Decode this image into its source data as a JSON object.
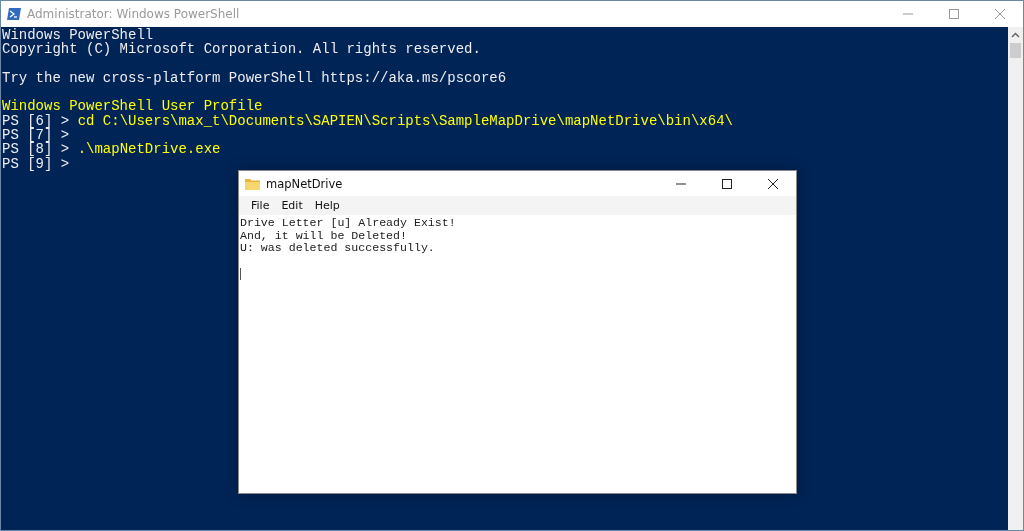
{
  "console_window": {
    "title": "Administrator: Windows PowerShell",
    "lines": [
      {
        "kind": "text",
        "segments": [
          {
            "kind": "output",
            "text": "Windows PowerShell"
          }
        ]
      },
      {
        "kind": "text",
        "segments": [
          {
            "kind": "output",
            "text": "Copyright (C) Microsoft Corporation. All rights reserved."
          }
        ]
      },
      {
        "kind": "blank"
      },
      {
        "kind": "text",
        "segments": [
          {
            "kind": "output",
            "text": "Try the new cross-platform PowerShell https://aka.ms/pscore6"
          }
        ]
      },
      {
        "kind": "blank"
      },
      {
        "kind": "text",
        "segments": [
          {
            "kind": "highlight",
            "text": "Windows PowerShell User Profile"
          }
        ]
      },
      {
        "kind": "text",
        "segments": [
          {
            "kind": "output",
            "text": "PS [6] > "
          },
          {
            "kind": "highlight",
            "text": "cd C:\\Users\\max_t\\Documents\\SAPIEN\\Scripts\\SampleMapDrive\\mapNetDrive\\bin\\x64\\"
          }
        ]
      },
      {
        "kind": "text",
        "segments": [
          {
            "kind": "output",
            "text": "PS [7] >"
          }
        ]
      },
      {
        "kind": "text",
        "segments": [
          {
            "kind": "output",
            "text": "PS [8] > "
          },
          {
            "kind": "highlight",
            "text": ".\\mapNetDrive.exe"
          }
        ]
      },
      {
        "kind": "text",
        "segments": [
          {
            "kind": "output",
            "text": "PS [9] >"
          }
        ]
      }
    ]
  },
  "app_window": {
    "title": "mapNetDrive",
    "menu": [
      "File",
      "Edit",
      "Help"
    ],
    "lines": [
      "Drive Letter [u] Already Exist!",
      "And, it will be Deleted!",
      "U: was deleted successfully."
    ],
    "cursor_visible": true
  }
}
